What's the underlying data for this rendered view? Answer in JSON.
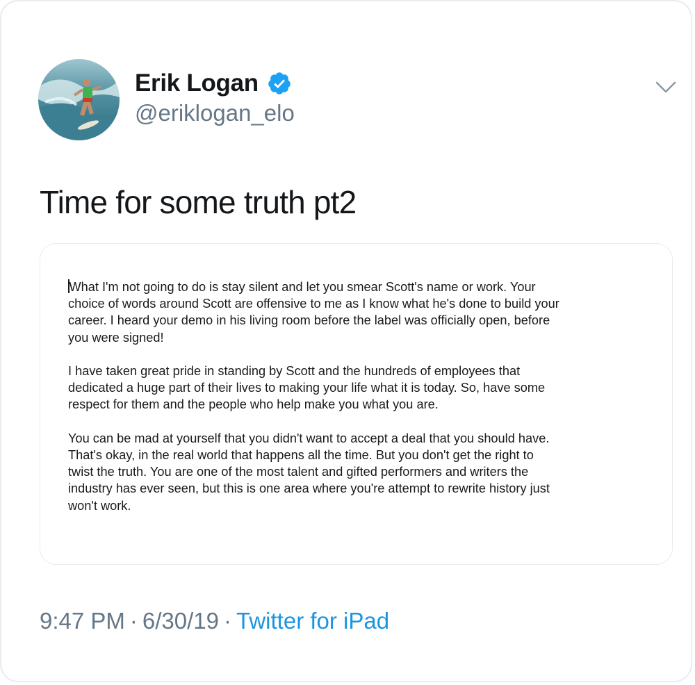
{
  "author": {
    "display_name": "Erik Logan",
    "handle": "@eriklogan_elo",
    "verified": true,
    "avatar_icon": "surfer-avatar-photo"
  },
  "tweet": {
    "text": "Time for some truth pt2",
    "timestamp_time": "9:47 PM",
    "timestamp_date": "6/30/19",
    "source": "Twitter for iPad",
    "separator": "·"
  },
  "attachment": {
    "paragraphs": [
      "What I'm not going to do is stay silent and let you smear Scott's name or work.  Your\nchoice of words around Scott are offensive to me as I know what he's done to build your\ncareer.  I heard your demo in his living room before the label was officially open, before\nyou were signed!",
      "I have taken great pride in standing by Scott and the hundreds of employees that\ndedicated a huge part of their lives to making your life what it is today.  So, have some\nrespect for them and the people who help make you what you are.",
      "You can be mad at yourself that you didn't want to accept a deal that you should have.\nThat's okay, in the real world that happens all the time.  But you don't get the right to\ntwist the truth.  You are one of the most talent and gifted performers and writers the\nindustry has ever seen, but this is one area where you're attempt to rewrite history just\nwon't work."
    ]
  },
  "colors": {
    "text_primary": "#14171a",
    "text_secondary": "#657786",
    "link": "#1b95e0",
    "verified_badge": "#1da1f2",
    "border": "#e6ecf0"
  },
  "icons": {
    "verified": "verified-badge-icon",
    "menu": "chevron-down-icon"
  }
}
